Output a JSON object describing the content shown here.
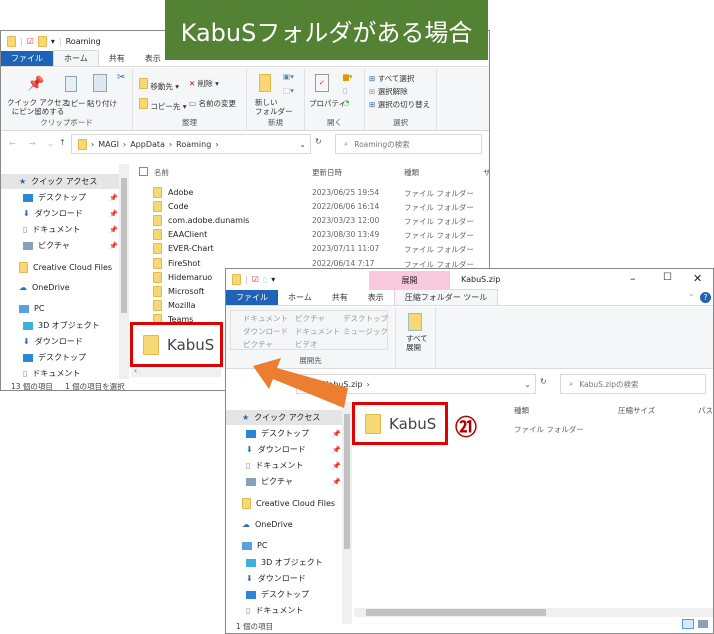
{
  "banner": {
    "text": "KabuSフォルダがある場合",
    "color": "#548235"
  },
  "win1": {
    "title": "Roaming",
    "tabs": [
      "ファイル",
      "ホーム",
      "共有",
      "表示"
    ],
    "ribbon": {
      "clipboard": {
        "pin": "クイック アクセス\nにピン留めする",
        "copy": "コピー",
        "paste": "貼り付け",
        "label": "クリップボード"
      },
      "organize": {
        "move": "移動先 ▾",
        "delete": "削除 ▾",
        "copyto": "コピー先 ▾",
        "rename": "名前の変更",
        "label": "整理"
      },
      "new": {
        "folder": "新しい\nフォルダー",
        "label": "新規"
      },
      "open": {
        "props": "プロパティ",
        "label": "開く"
      },
      "select": {
        "all": "すべて選択",
        "none": "選択解除",
        "invert": "選択の切り替え",
        "label": "選択"
      }
    },
    "address": {
      "crumbs": [
        "MAGI",
        "AppData",
        "Roaming"
      ],
      "search_placeholder": "Roamingの検索"
    },
    "columns": {
      "name": "名前",
      "date": "更新日時",
      "type": "種類",
      "size": "サ"
    },
    "nav": [
      "クイック アクセス",
      "デスクトップ",
      "ダウンロード",
      "ドキュメント",
      "ピクチャ",
      "Creative Cloud Files",
      "OneDrive",
      "PC",
      "3D オブジェクト",
      "ダウンロード",
      "デスクトップ",
      "ドキュメント"
    ],
    "files": [
      {
        "name": "Adobe",
        "date": "2023/06/25 19:54",
        "type": "ファイル フォルダー"
      },
      {
        "name": "Code",
        "date": "2022/06/06 16:14",
        "type": "ファイル フォルダー"
      },
      {
        "name": "com.adobe.dunamis",
        "date": "2023/03/23 12:00",
        "type": "ファイル フォルダー"
      },
      {
        "name": "EAAClient",
        "date": "2023/08/30 13:49",
        "type": "ファイル フォルダー"
      },
      {
        "name": "EVER-Chart",
        "date": "2023/07/11 11:07",
        "type": "ファイル フォルダー"
      },
      {
        "name": "FireShot",
        "date": "2022/06/14 7:17",
        "type": "ファイル フォルダー"
      },
      {
        "name": "Hidemaruo"
      },
      {
        "name": "Microsoft"
      },
      {
        "name": "Mozilla"
      },
      {
        "name": "Teams"
      }
    ],
    "highlight": "KabuS",
    "status": {
      "count": "13 個の項目",
      "selected": "1 個の項目を選択"
    }
  },
  "win2": {
    "title": "KabuS.zip",
    "context_tab": "展開",
    "context_color": "#f9c9de",
    "tabs": [
      "ファイル",
      "ホーム",
      "共有",
      "表示",
      "圧縮フォルダー ツール"
    ],
    "ribbon": {
      "dest": [
        "ドキュメント",
        "ピクチャ",
        "デスクトップ",
        "ダウンロード",
        "ドキュメント",
        "ミュージック",
        "ピクチャ",
        "ビデオ"
      ],
      "dest_label": "展開先",
      "extract_all": "すべて\n展開"
    },
    "address": {
      "crumbs": [
        "KabuS.zip"
      ],
      "search_placeholder": "KabuS.zipの検索"
    },
    "columns": {
      "type": "種類",
      "csize": "圧縮サイズ",
      "pw": "パス"
    },
    "nav": [
      "クイック アクセス",
      "デスクトップ",
      "ダウンロード",
      "ドキュメント",
      "ピクチャ",
      "Creative Cloud Files",
      "OneDrive",
      "PC",
      "3D オブジェクト",
      "ダウンロード",
      "デスクトップ",
      "ドキュメント"
    ],
    "file": {
      "name": "KabuS",
      "type": "ファイル フォルダー"
    },
    "step": "㉑",
    "status": {
      "count": "1 個の項目"
    }
  },
  "colors": {
    "highlight": "#e00000",
    "arrow": "#ed7d31",
    "step": "#b00000"
  }
}
